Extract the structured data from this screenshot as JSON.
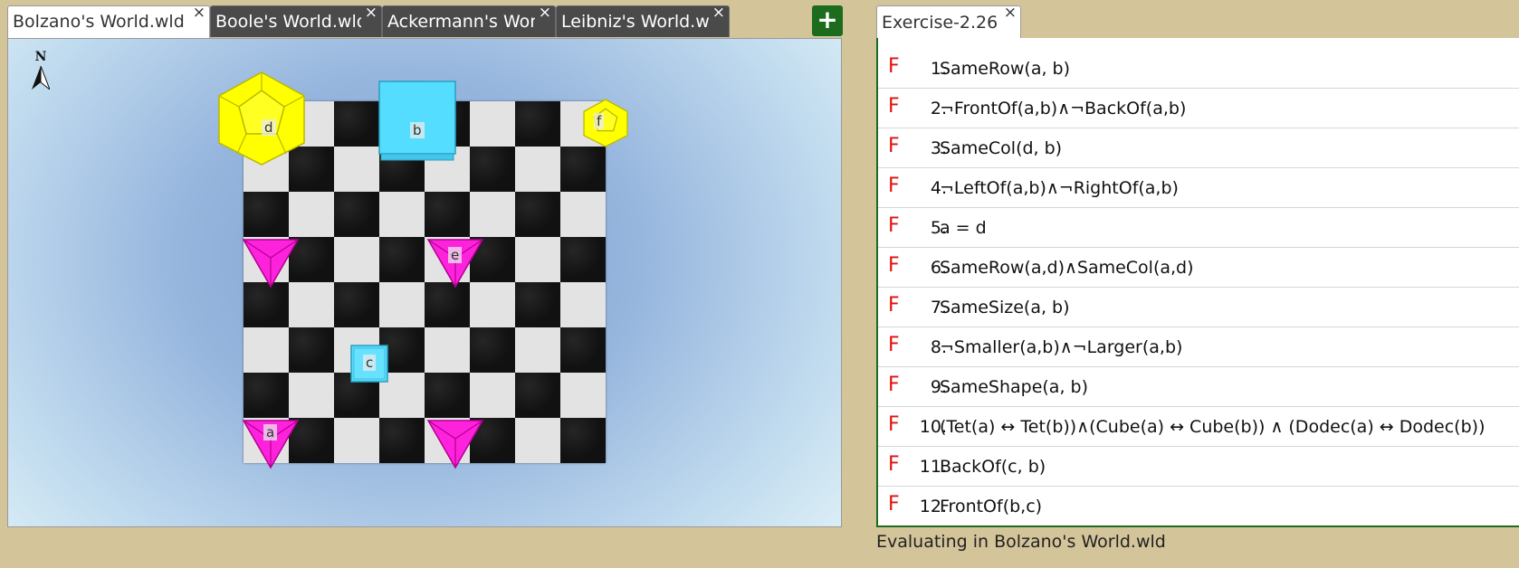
{
  "world_tabs": [
    {
      "label": "Bolzano's World.wld",
      "active": true
    },
    {
      "label": "Boole's World.wld",
      "active": false
    },
    {
      "label": "Ackermann's World.wld",
      "active": false
    },
    {
      "label": "Leibniz's World.wld",
      "active": false
    }
  ],
  "close_glyph": "×",
  "add_tab_label": "+",
  "compass_label": "N",
  "blocks": {
    "a": "a",
    "b": "b",
    "c": "c",
    "d": "d",
    "e": "e",
    "f": "f"
  },
  "colors": {
    "background": "#d4c49a",
    "add_button": "#1d6b1d",
    "truth_false": "#e01010",
    "dodec_yellow": "#ffff00",
    "cube_blue": "#55ddff",
    "tet_magenta": "#ff22dd"
  },
  "sentence_tab": {
    "label": "Exercise-2.26"
  },
  "sentences": [
    {
      "truth": "F",
      "num": "1.",
      "formula": "SameRow(a, b)"
    },
    {
      "truth": "F",
      "num": "2.",
      "formula": "¬FrontOf(a,b)∧¬BackOf(a,b)"
    },
    {
      "truth": "F",
      "num": "3.",
      "formula": "SameCol(d, b)"
    },
    {
      "truth": "F",
      "num": "4.",
      "formula": "¬LeftOf(a,b)∧¬RightOf(a,b)"
    },
    {
      "truth": "F",
      "num": "5.",
      "formula": "a = d"
    },
    {
      "truth": "F",
      "num": "6.",
      "formula": "SameRow(a,d)∧SameCol(a,d)"
    },
    {
      "truth": "F",
      "num": "7.",
      "formula": "SameSize(a, b)"
    },
    {
      "truth": "F",
      "num": "8.",
      "formula": "¬Smaller(a,b)∧¬Larger(a,b)"
    },
    {
      "truth": "F",
      "num": "9.",
      "formula": "SameShape(a, b)"
    },
    {
      "truth": "F",
      "num": "10.",
      "formula": "(Tet(a) ↔ Tet(b))∧(Cube(a) ↔ Cube(b)) ∧ (Dodec(a) ↔ Dodec(b))"
    },
    {
      "truth": "F",
      "num": "11.",
      "formula": "BackOf(c, b)"
    },
    {
      "truth": "F",
      "num": "12.",
      "formula": "FrontOf(b,c)"
    }
  ],
  "status": "Evaluating in Bolzano's World.wld"
}
